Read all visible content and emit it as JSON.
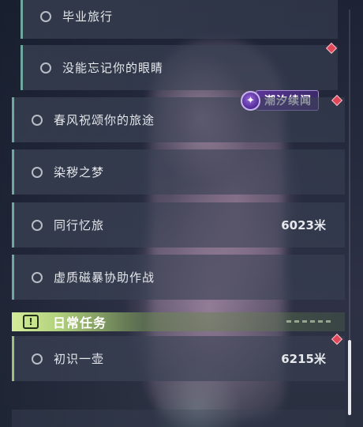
{
  "quest_list": {
    "sub_items": [
      {
        "label": "毕业旅行"
      },
      {
        "label": "没能忘记你的眼睛"
      }
    ],
    "event_badge": {
      "label": "潮汐续闻"
    },
    "main_items": [
      {
        "label": "春风祝颂你的旅途"
      },
      {
        "label": "染秽之梦"
      },
      {
        "label": "同行忆旅",
        "distance": "6023米"
      },
      {
        "label": "虚质磁暴协助作战"
      }
    ],
    "daily_section": {
      "title": "日常任务",
      "icon": "alert-icon",
      "items": [
        {
          "label": "初识一壶",
          "distance": "6215米"
        }
      ]
    }
  },
  "colors": {
    "accent_teal": "#6ea8a0",
    "daily_green": "#b2d27c",
    "tracked_marker": "#e0485a",
    "event_purple": "#5a3596"
  }
}
